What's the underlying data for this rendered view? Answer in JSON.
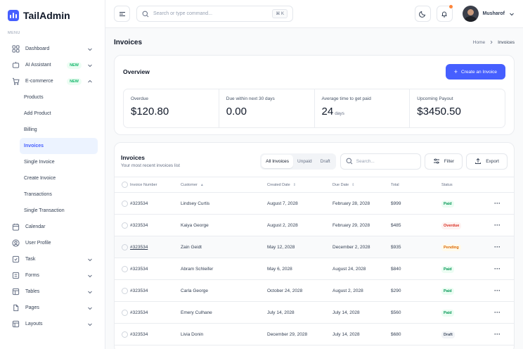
{
  "brand": {
    "name": "TailAdmin",
    "accent": "#465fff"
  },
  "sidebar": {
    "menu_heading": "MENU",
    "items": [
      {
        "label": "Dashboard",
        "icon": "grid-icon",
        "has_chevron": true
      },
      {
        "label": "AI Assistant",
        "icon": "ai-icon",
        "badge": "NEW",
        "has_chevron": true
      },
      {
        "label": "E-commerce",
        "icon": "cart-icon",
        "badge": "NEW",
        "has_chevron": true,
        "expanded": true
      }
    ],
    "sub_items": [
      "Products",
      "Add Product",
      "Billing",
      "Invoices",
      "Single Invoice",
      "Create Invoice",
      "Transactions",
      "Single Transaction"
    ],
    "active_sub": "Invoices",
    "items_after": [
      {
        "label": "Calendar",
        "icon": "calendar-icon"
      },
      {
        "label": "User Profile",
        "icon": "user-icon"
      },
      {
        "label": "Task",
        "icon": "task-icon",
        "has_chevron": true
      },
      {
        "label": "Forms",
        "icon": "forms-icon",
        "has_chevron": true
      },
      {
        "label": "Tables",
        "icon": "table-icon",
        "has_chevron": true
      },
      {
        "label": "Pages",
        "icon": "pages-icon",
        "has_chevron": true
      },
      {
        "label": "Layouts",
        "icon": "layouts-icon",
        "has_chevron": true
      }
    ]
  },
  "topbar": {
    "search_placeholder": "Search or type command...",
    "shortcut": "⌘ K",
    "user_name": "Musharof"
  },
  "page": {
    "title": "Invoices",
    "breadcrumb": [
      "Home",
      "Invoices"
    ]
  },
  "overview": {
    "title": "Overview",
    "create_button": "Create an Invoice",
    "stats": [
      {
        "label": "Overdue",
        "value": "$120.80",
        "unit": ""
      },
      {
        "label": "Due within next 30 days",
        "value": "0.00",
        "unit": ""
      },
      {
        "label": "Average time to get paid",
        "value": "24",
        "unit": "days"
      },
      {
        "label": "Upcoming Payout",
        "value": "$3450.50",
        "unit": ""
      }
    ]
  },
  "invoices": {
    "title": "Invoices",
    "subtitle": "Your most recent invoices list",
    "tabs": [
      "All Invoices",
      "Unpaid",
      "Draft"
    ],
    "active_tab": "All Invoices",
    "search_placeholder": "Search...",
    "filter_label": "Filter",
    "export_label": "Export",
    "columns": [
      "Invoice Number",
      "Customer",
      "Created Date",
      "Due Date",
      "Total",
      "Status"
    ],
    "rows": [
      {
        "number": "#323534",
        "customer": "Lindsey Curtis",
        "created": "August 7, 2028",
        "due": "February 28, 2028",
        "total": "$999",
        "status": "Paid"
      },
      {
        "number": "#323534",
        "customer": "Kaiya George",
        "created": "August 2, 2028",
        "due": "February 29, 2028",
        "total": "$485",
        "status": "Overdue"
      },
      {
        "number": "#323534",
        "customer": "Zain Geidt",
        "created": "May 12, 2028",
        "due": "December 2, 2028",
        "total": "$935",
        "status": "Pending"
      },
      {
        "number": "#323534",
        "customer": "Abram Schleifer",
        "created": "May 6, 2028",
        "due": "August 24, 2028",
        "total": "$840",
        "status": "Paid"
      },
      {
        "number": "#323534",
        "customer": "Carla George",
        "created": "October 24, 2028",
        "due": "August 2, 2028",
        "total": "$290",
        "status": "Paid"
      },
      {
        "number": "#323534",
        "customer": "Emery Culhane",
        "created": "July 14, 2028",
        "due": "July 14, 2028",
        "total": "$560",
        "status": "Paid"
      },
      {
        "number": "#323534",
        "customer": "Livia Donin",
        "created": "December 29, 2028",
        "due": "July 14, 2028",
        "total": "$680",
        "status": "Draft"
      }
    ]
  }
}
